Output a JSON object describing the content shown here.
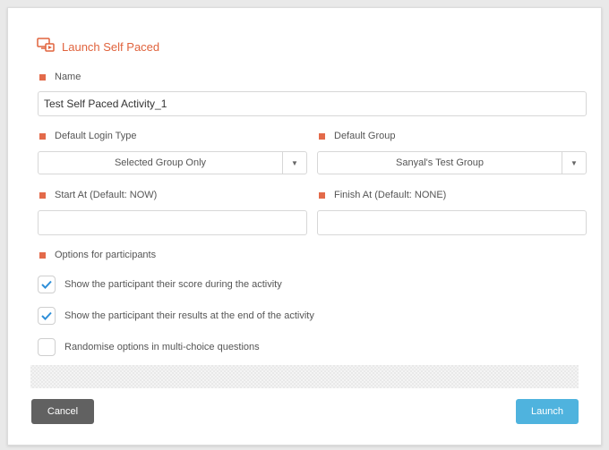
{
  "dialog": {
    "title": "Launch Self Paced",
    "icon": "launch-screen-icon",
    "accent_color": "#e0633d"
  },
  "form": {
    "name": {
      "label": "Name",
      "value": "Test Self Paced Activity_1"
    },
    "default_login_type": {
      "label": "Default Login Type",
      "selected": "Selected Group Only"
    },
    "default_group": {
      "label": "Default Group",
      "selected": "Sanyal's Test Group"
    },
    "start_at": {
      "label": "Start At (Default: NOW)",
      "value": ""
    },
    "finish_at": {
      "label": "Finish At (Default: NONE)",
      "value": ""
    },
    "options": {
      "label": "Options for participants",
      "items": [
        {
          "label": "Show the participant their score during the activity",
          "checked": true
        },
        {
          "label": "Show the participant their results at the end of the activity",
          "checked": true
        },
        {
          "label": "Randomise options in multi-choice questions",
          "checked": false
        }
      ]
    }
  },
  "buttons": {
    "cancel": "Cancel",
    "launch": "Launch"
  }
}
